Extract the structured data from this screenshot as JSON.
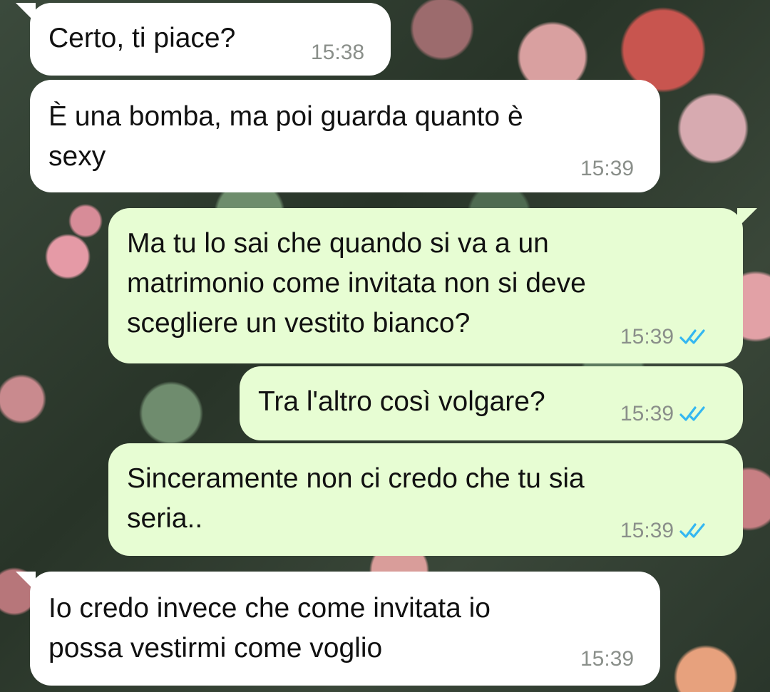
{
  "messages": [
    {
      "direction": "in",
      "text": "Certo, ti piace?",
      "time": "15:38"
    },
    {
      "direction": "in",
      "text": "È una bomba, ma poi guarda quanto è\nsexy",
      "time": "15:39"
    },
    {
      "direction": "out",
      "text": "Ma tu lo sai che quando si va a un\nmatrimonio come invitata non si deve\nscegliere un vestito bianco?",
      "time": "15:39",
      "status_icon": "double-check-read-icon"
    },
    {
      "direction": "out",
      "text": "Tra l'altro così volgare?",
      "time": "15:39",
      "status_icon": "double-check-read-icon"
    },
    {
      "direction": "out",
      "text": "Sinceramente non ci credo che tu sia\nseria..",
      "time": "15:39",
      "status_icon": "double-check-read-icon"
    },
    {
      "direction": "in",
      "text": "Io credo invece che come invitata io\npossa vestirmi come voglio",
      "time": "15:39"
    }
  ],
  "colors": {
    "incoming_bubble": "#ffffff",
    "outgoing_bubble": "#e7fdd3",
    "timestamp": "#8a8f8a",
    "read_ticks": "#34b7f1"
  }
}
